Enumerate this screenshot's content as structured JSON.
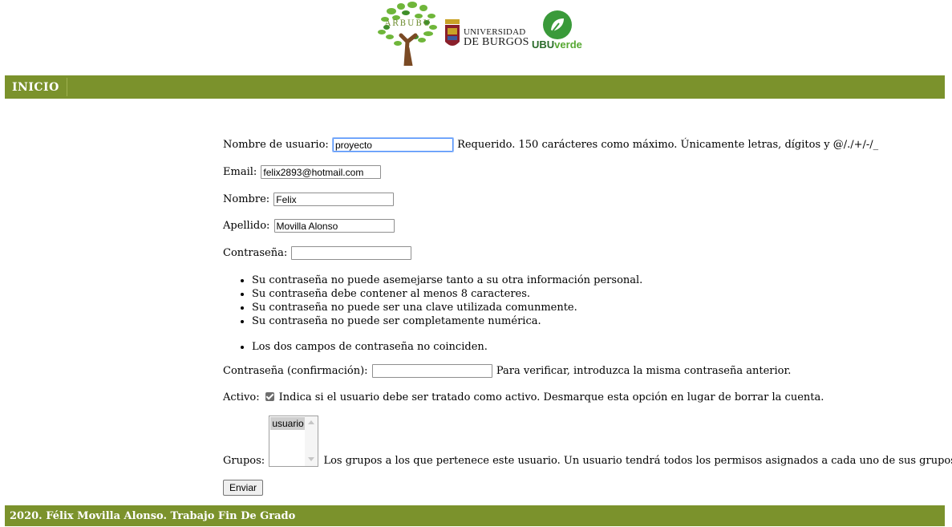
{
  "header": {
    "logos": {
      "arbubu": "ARBUBU",
      "ubu_line1": "UNIVERSIDAD",
      "ubu_line2": "DE BURGOS",
      "ubuverde_a": "UBU",
      "ubuverde_b": "verde"
    }
  },
  "nav": {
    "items": [
      {
        "label": "INICIO"
      }
    ]
  },
  "form": {
    "username": {
      "label": "Nombre de usuario:",
      "value": "proyecto",
      "help": "Requerido. 150 carácteres como máximo. Únicamente letras, dígitos y @/./+/-/_"
    },
    "email": {
      "label": "Email:",
      "value": "felix2893@hotmail.com"
    },
    "first_name": {
      "label": "Nombre:",
      "value": "Felix"
    },
    "last_name": {
      "label": "Apellido:",
      "value": "Movilla Alonso"
    },
    "password": {
      "label": "Contraseña:",
      "value": "",
      "rules": [
        "Su contraseña no puede asemejarse tanto a su otra información personal.",
        "Su contraseña debe contener al menos 8 caracteres.",
        "Su contraseña no puede ser una clave utilizada comunmente.",
        "Su contraseña no puede ser completamente numérica."
      ],
      "error": "Los dos campos de contraseña no coinciden."
    },
    "password_confirm": {
      "label": "Contraseña (confirmación):",
      "value": "",
      "help": "Para verificar, introduzca la misma contraseña anterior."
    },
    "active": {
      "label": "Activo:",
      "checked": true,
      "help": "Indica si el usuario debe ser tratado como activo. Desmarque esta opción en lugar de borrar la cuenta."
    },
    "groups": {
      "label": "Grupos:",
      "options": [
        "usuario"
      ],
      "help": "Los grupos a los que pertenece este usuario. Un usuario tendrá todos los permisos asignados a cada uno de sus grupos."
    },
    "submit_label": "Enviar"
  },
  "footer": {
    "text": "2020. Félix Movilla Alonso. Trabajo Fin De Grado"
  },
  "colors": {
    "bar_green": "#7b922c",
    "focus_blue": "#4d90fe"
  }
}
